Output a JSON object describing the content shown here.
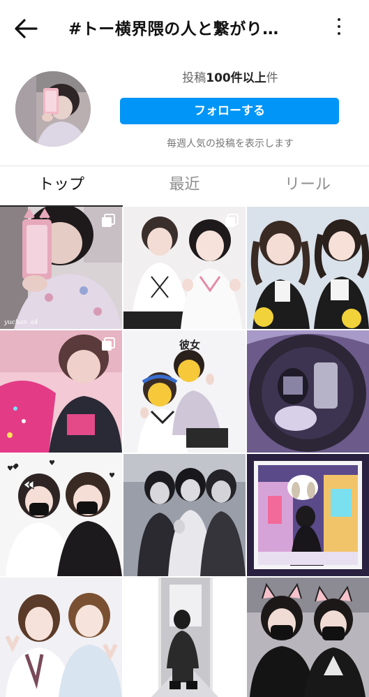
{
  "header": {
    "title": "#トー横界隈の人と繋がり…",
    "back_icon": "arrow-left-icon",
    "more_icon": "more-vertical-icon"
  },
  "profile": {
    "post_count_prefix": "投稿",
    "post_count_value": "100件以上",
    "post_count_suffix": "件",
    "follow_label": "フォローする",
    "weekly_note": "毎週人気の投稿を表示します"
  },
  "tabs": [
    {
      "label": "トップ",
      "active": true
    },
    {
      "label": "最近",
      "active": false
    },
    {
      "label": "リール",
      "active": false
    }
  ],
  "grid": {
    "sticker_text": "彼女",
    "watermark_text": "yuchan_a4",
    "posts": [
      {
        "kind": "mirror-selfie",
        "multi": true
      },
      {
        "kind": "two-girls-white",
        "multi": true
      },
      {
        "kind": "two-girls-twintails",
        "multi": false
      },
      {
        "kind": "pink-blur",
        "multi": true
      },
      {
        "kind": "stickers-pose",
        "multi": false
      },
      {
        "kind": "purple-mirror",
        "multi": false
      },
      {
        "kind": "masked-hearts",
        "multi": false
      },
      {
        "kind": "group-bw",
        "multi": false
      },
      {
        "kind": "arcade-night",
        "multi": false
      },
      {
        "kind": "peace-signs",
        "multi": false
      },
      {
        "kind": "hallway",
        "multi": false
      },
      {
        "kind": "cat-ears",
        "multi": false
      }
    ]
  },
  "colors": {
    "accent": "#0095f6",
    "text": "#262626",
    "muted": "#8e8e8e"
  }
}
